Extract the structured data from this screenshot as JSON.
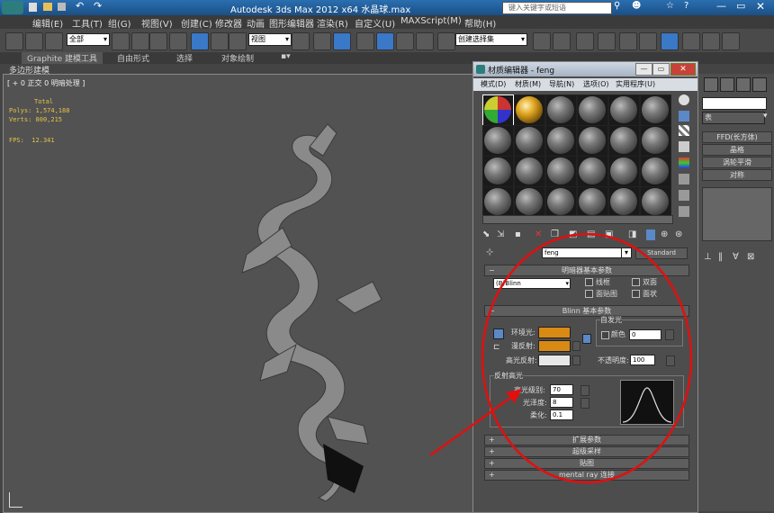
{
  "titlebar": {
    "title": "Autodesk 3ds Max  2012 x64    水晶球.max",
    "search_placeholder": "键入关键字或短语"
  },
  "menubar": {
    "items": [
      "编辑(E)",
      "工具(T)",
      "组(G)",
      "视图(V)",
      "创建(C)",
      "修改器",
      "动画",
      "图形编辑器",
      "渲染(R)",
      "自定义(U)",
      "MAXScript(M)",
      "帮助(H)"
    ]
  },
  "toolbar": {
    "selection_filter": "全部",
    "view_dropdown": "视图",
    "named_sel": "创建选择集"
  },
  "ribbon": {
    "tabs": [
      "Graphite 建模工具",
      "自由形式",
      "选择",
      "对象绘制"
    ],
    "sub": "多边形建模"
  },
  "viewport": {
    "label": "[ + 0 正交 0 明暗处理 ]",
    "stats": {
      "total": "Total",
      "polys_label": "Polys:",
      "polys": "1,574,188",
      "verts_label": "Verts:",
      "verts": "800,215",
      "fps_label": "FPS:",
      "fps": "12.341"
    }
  },
  "cmd": {
    "items": [
      "FFD(长方体)",
      "晶格",
      "涡轮平滑",
      "对称"
    ],
    "frag": "表"
  },
  "mat_editor": {
    "title": "材质编辑器 - feng",
    "menus": [
      "模式(D)",
      "材质(M)",
      "导航(N)",
      "选项(O)",
      "实用程序(U)"
    ],
    "mat_name": "feng",
    "mat_type": "Standard",
    "shader_rollout": "明暗器基本参数",
    "shader": "(B)Blinn",
    "opts": [
      "线框",
      "双面",
      "面贴图",
      "面状"
    ],
    "blinn_rollout": "Blinn 基本参数",
    "self_illum": "自发光",
    "color_label": "颜色",
    "color_val": "0",
    "ambient": "环境光:",
    "diffuse": "漫反射:",
    "specular": "高光反射:",
    "opacity_label": "不透明度:",
    "opacity": "100",
    "spec_group": "反射高光",
    "spec_level_label": "高光级别:",
    "spec_level": "70",
    "gloss_label": "光泽度:",
    "gloss": "8",
    "soften_label": "柔化:",
    "soften": "0.1",
    "rollouts": [
      "扩展参数",
      "超级采样",
      "贴图",
      "mental ray 连接"
    ]
  },
  "colors": {
    "ambient": "#d98a14",
    "diffuse": "#d98a14",
    "specular": "#e8e8e8",
    "annotation": "#e01010"
  }
}
